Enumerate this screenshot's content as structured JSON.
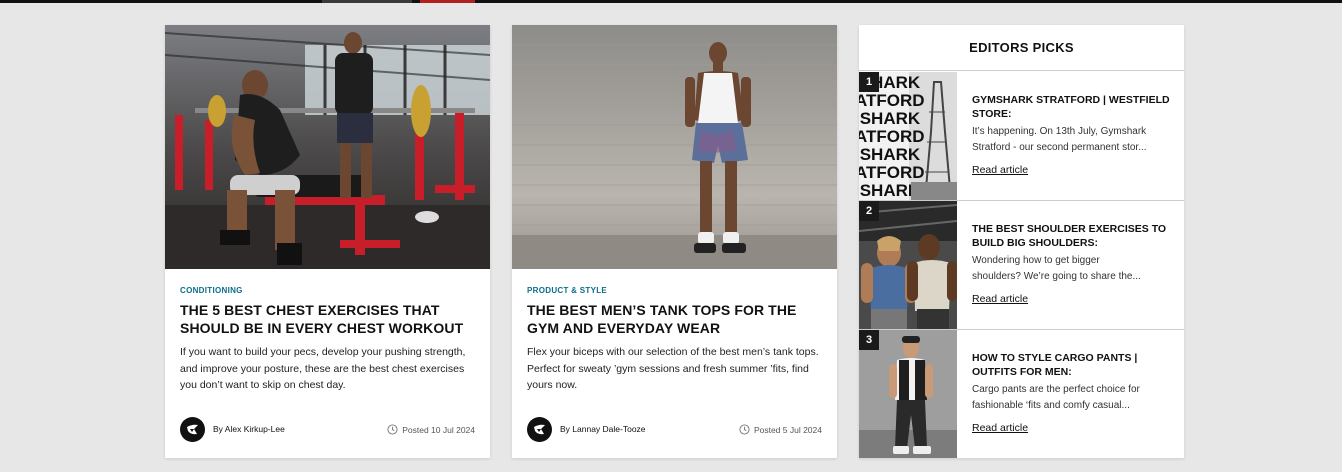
{
  "cards": [
    {
      "category": "CONDITIONING",
      "title": "THE 5 BEST CHEST EXERCISES THAT SHOULD BE IN EVERY CHEST WORKOUT",
      "excerpt": "If you want to build your pecs, develop your pushing strength, and improve your posture, these are the best chest exercises you don’t want to skip on chest day.",
      "author": "By Alex Kirkup-Lee",
      "posted": "Posted 10 Jul 2024",
      "image": "gym-bench-photo"
    },
    {
      "category": "PRODUCT & STYLE",
      "title": "THE BEST MEN’S TANK TOPS FOR THE GYM AND EVERYDAY WEAR",
      "excerpt": "Flex your biceps with our selection of the best men’s tank tops. Perfect for sweaty ’gym sessions and fresh summer ’fits, find yours now.",
      "author": "By Lannay Dale-Tooze",
      "posted": "Posted 5 Jul 2024",
      "image": "tank-top-model-photo"
    }
  ],
  "editors_picks": {
    "heading": "EDITORS PICKS",
    "items": [
      {
        "number": "1",
        "title": "GYMSHARK STRATFORD | WESTFIELD STORE:",
        "excerpt_line1": "It’s happening. On 13th July, Gymshark",
        "excerpt_line2": "Stratford - our second permanent stor...",
        "link": "Read article",
        "thumb_text": [
          "ISHARK",
          "ATFORD",
          "ISHARK",
          "ATFORD",
          "ISHARK",
          "ATFORD",
          "ISHARK"
        ]
      },
      {
        "number": "2",
        "title": "THE BEST SHOULDER EXERCISES TO BUILD BIG SHOULDERS:",
        "excerpt_line1": "Wondering how to get bigger",
        "excerpt_line2": "shoulders? We’re going to share the...",
        "link": "Read article"
      },
      {
        "number": "3",
        "title": "HOW TO STYLE CARGO PANTS | OUTFITS FOR MEN:",
        "excerpt_line1": "Cargo pants are the perfect choice for",
        "excerpt_line2": "fashionable ‘fits and comfy casual...",
        "link": "Read article"
      }
    ]
  },
  "colors": {
    "page_bg": "#e7e7e7",
    "category": "#0b6e8a",
    "text": "#111111"
  },
  "icons": [
    "gymshark-logo-icon",
    "clock-icon"
  ]
}
